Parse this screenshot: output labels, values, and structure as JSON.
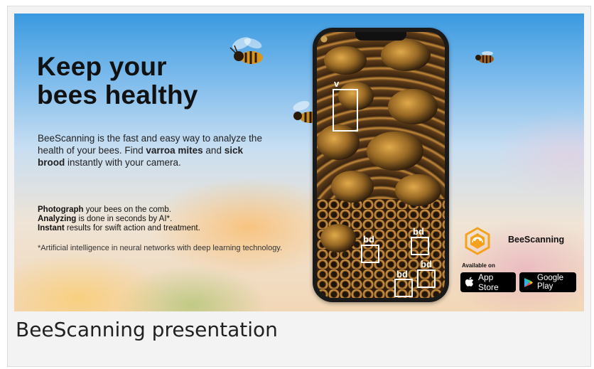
{
  "banner": {
    "headline": [
      "Keep your",
      "bees healthy"
    ],
    "intro": {
      "line1": "BeeScanning is the fast and easy way to analyze the health of your bees.",
      "find_prefix": "Find ",
      "varroa": "varroa mites",
      "and": " and ",
      "sick_brood": "sick brood",
      "instantly": " instantly with your camera."
    },
    "features": [
      {
        "bold": "Photograph",
        "rest": " your bees on the comb."
      },
      {
        "bold": "Analyzing",
        "rest": " is done in seconds by AI*."
      },
      {
        "bold": "Instant",
        "rest": " results for swift action and treatment."
      }
    ],
    "footnote": "*Artificial intelligence in neural networks with deep learning technology.",
    "phone_tags": {
      "v": "v",
      "bd": "bd"
    },
    "brand": {
      "name": "BeeScanning",
      "logo_color": "#f4a21d"
    },
    "available_on": "Available on",
    "stores": {
      "app_store": "App Store",
      "google_play": "Google Play"
    }
  },
  "caption": "BeeScanning presentation"
}
